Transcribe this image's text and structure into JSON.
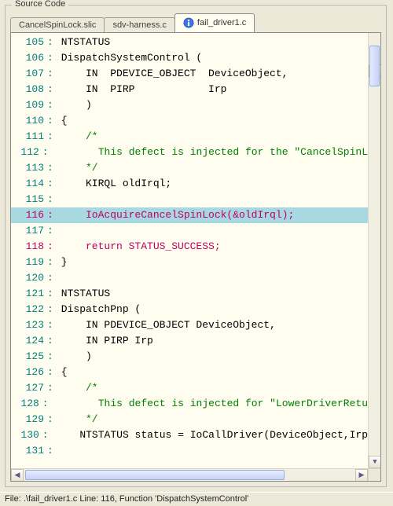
{
  "panel": {
    "title": "Source Code"
  },
  "tabs": [
    {
      "label": "CancelSpinLock.slic",
      "active": false,
      "has_icon": false
    },
    {
      "label": "sdv-harness.c",
      "active": false,
      "has_icon": false
    },
    {
      "label": "fail_driver1.c",
      "active": true,
      "has_icon": true,
      "icon": "info-icon"
    }
  ],
  "code_lines": [
    {
      "n": 105,
      "style": "default",
      "text": "NTSTATUS"
    },
    {
      "n": 106,
      "style": "default",
      "text": "DispatchSystemControl ("
    },
    {
      "n": 107,
      "style": "default",
      "text": "    IN  PDEVICE_OBJECT  DeviceObject,"
    },
    {
      "n": 108,
      "style": "default",
      "text": "    IN  PIRP            Irp"
    },
    {
      "n": 109,
      "style": "default",
      "text": "    )"
    },
    {
      "n": 110,
      "style": "default",
      "text": "{"
    },
    {
      "n": 111,
      "style": "comment",
      "text": "    /*"
    },
    {
      "n": 112,
      "style": "comment",
      "text": "       This defect is injected for the \"CancelSpinL"
    },
    {
      "n": 113,
      "style": "comment",
      "text": "    */"
    },
    {
      "n": 114,
      "style": "default",
      "text": "    KIRQL oldIrql;"
    },
    {
      "n": 115,
      "style": "default",
      "text": ""
    },
    {
      "n": 116,
      "style": "highlight",
      "text": "    IoAcquireCancelSpinLock(&oldIrql);"
    },
    {
      "n": 117,
      "style": "default",
      "text": ""
    },
    {
      "n": 118,
      "style": "return",
      "text": "    return STATUS_SUCCESS;"
    },
    {
      "n": 119,
      "style": "default",
      "text": "}"
    },
    {
      "n": 120,
      "style": "default",
      "text": ""
    },
    {
      "n": 121,
      "style": "default",
      "text": "NTSTATUS"
    },
    {
      "n": 122,
      "style": "default",
      "text": "DispatchPnp ("
    },
    {
      "n": 123,
      "style": "default",
      "text": "    IN PDEVICE_OBJECT DeviceObject,"
    },
    {
      "n": 124,
      "style": "default",
      "text": "    IN PIRP Irp"
    },
    {
      "n": 125,
      "style": "default",
      "text": "    )"
    },
    {
      "n": 126,
      "style": "default",
      "text": "{"
    },
    {
      "n": 127,
      "style": "comment",
      "text": "    /*"
    },
    {
      "n": 128,
      "style": "comment",
      "text": "       This defect is injected for \"LowerDriverRetu"
    },
    {
      "n": 129,
      "style": "comment",
      "text": "    */"
    },
    {
      "n": 130,
      "style": "default",
      "text": "    NTSTATUS status = IoCallDriver(DeviceObject,Irp"
    },
    {
      "n": 131,
      "style": "default",
      "text": ""
    }
  ],
  "scroll": {
    "up_glyph": "▲",
    "down_glyph": "▼",
    "left_glyph": "◀",
    "right_glyph": "▶"
  },
  "status": {
    "text": "File: .\\fail_driver1.c   Line: 116,   Function 'DispatchSystemControl'"
  }
}
